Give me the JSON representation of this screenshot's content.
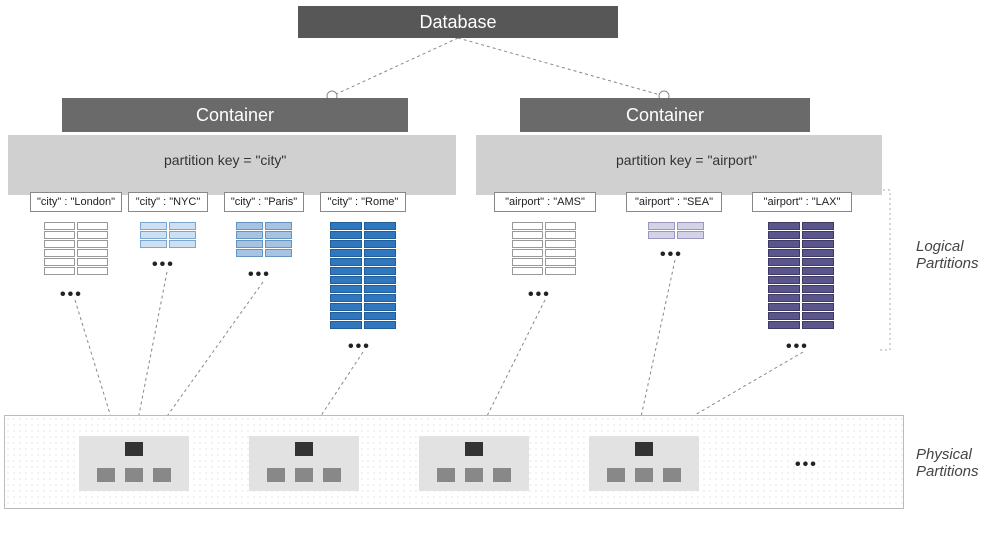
{
  "database": {
    "label": "Database"
  },
  "containers": [
    {
      "label": "Container",
      "partition_key_label": "partition key = \"city\"",
      "logical_partitions": [
        {
          "label": "\"city\" : \"London\"",
          "variant": "white",
          "rows": 6
        },
        {
          "label": "\"city\" : \"NYC\"",
          "variant": "blue1",
          "rows": 3
        },
        {
          "label": "\"city\" : \"Paris\"",
          "variant": "blue2",
          "rows": 4
        },
        {
          "label": "\"city\" : \"Rome\"",
          "variant": "blue3",
          "rows": 12
        }
      ]
    },
    {
      "label": "Container",
      "partition_key_label": "partition key = \"airport\"",
      "logical_partitions": [
        {
          "label": "\"airport\" : \"AMS\"",
          "variant": "white",
          "rows": 6
        },
        {
          "label": "\"airport\" : \"SEA\"",
          "variant": "purple1",
          "rows": 2
        },
        {
          "label": "\"airport\" : \"LAX\"",
          "variant": "purple2",
          "rows": 12
        }
      ]
    }
  ],
  "labels": {
    "logical": "Logical Partitions",
    "physical": "Physical Partitions"
  },
  "ellipsis": "•••"
}
